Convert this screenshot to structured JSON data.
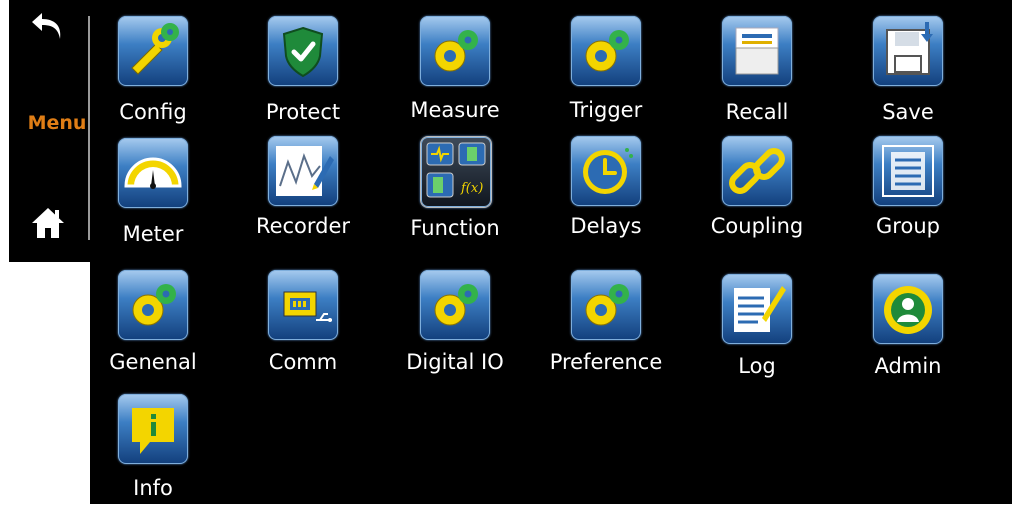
{
  "sidebar": {
    "back_icon": "back-arrow-icon",
    "menu_label": "Menu",
    "home_icon": "home-icon",
    "accent": "#e07e16"
  },
  "tiles": [
    {
      "label": "Config",
      "icon": "config-icon"
    },
    {
      "label": "Protect",
      "icon": "shield-icon"
    },
    {
      "label": "Measure",
      "icon": "gear-icon"
    },
    {
      "label": "Trigger",
      "icon": "gear-icon"
    },
    {
      "label": "Recall",
      "icon": "folder-icon"
    },
    {
      "label": "Save",
      "icon": "floppy-disk-icon"
    },
    {
      "label": "Meter",
      "icon": "gauge-icon"
    },
    {
      "label": "Recorder",
      "icon": "chart-pen-icon"
    },
    {
      "label": "Function",
      "icon": "function-icon"
    },
    {
      "label": "Delays",
      "icon": "clock-icon"
    },
    {
      "label": "Coupling",
      "icon": "chain-link-icon"
    },
    {
      "label": "Group",
      "icon": "group-frame-icon"
    },
    {
      "label": "Genenal",
      "icon": "gear-icon"
    },
    {
      "label": "Comm",
      "icon": "network-usb-icon"
    },
    {
      "label": "Digital IO",
      "icon": "gear-icon"
    },
    {
      "label": "Preference",
      "icon": "gear-icon"
    },
    {
      "label": "Log",
      "icon": "document-pen-icon"
    },
    {
      "label": "Admin",
      "icon": "user-gear-icon"
    },
    {
      "label": "Info",
      "icon": "info-icon"
    }
  ]
}
